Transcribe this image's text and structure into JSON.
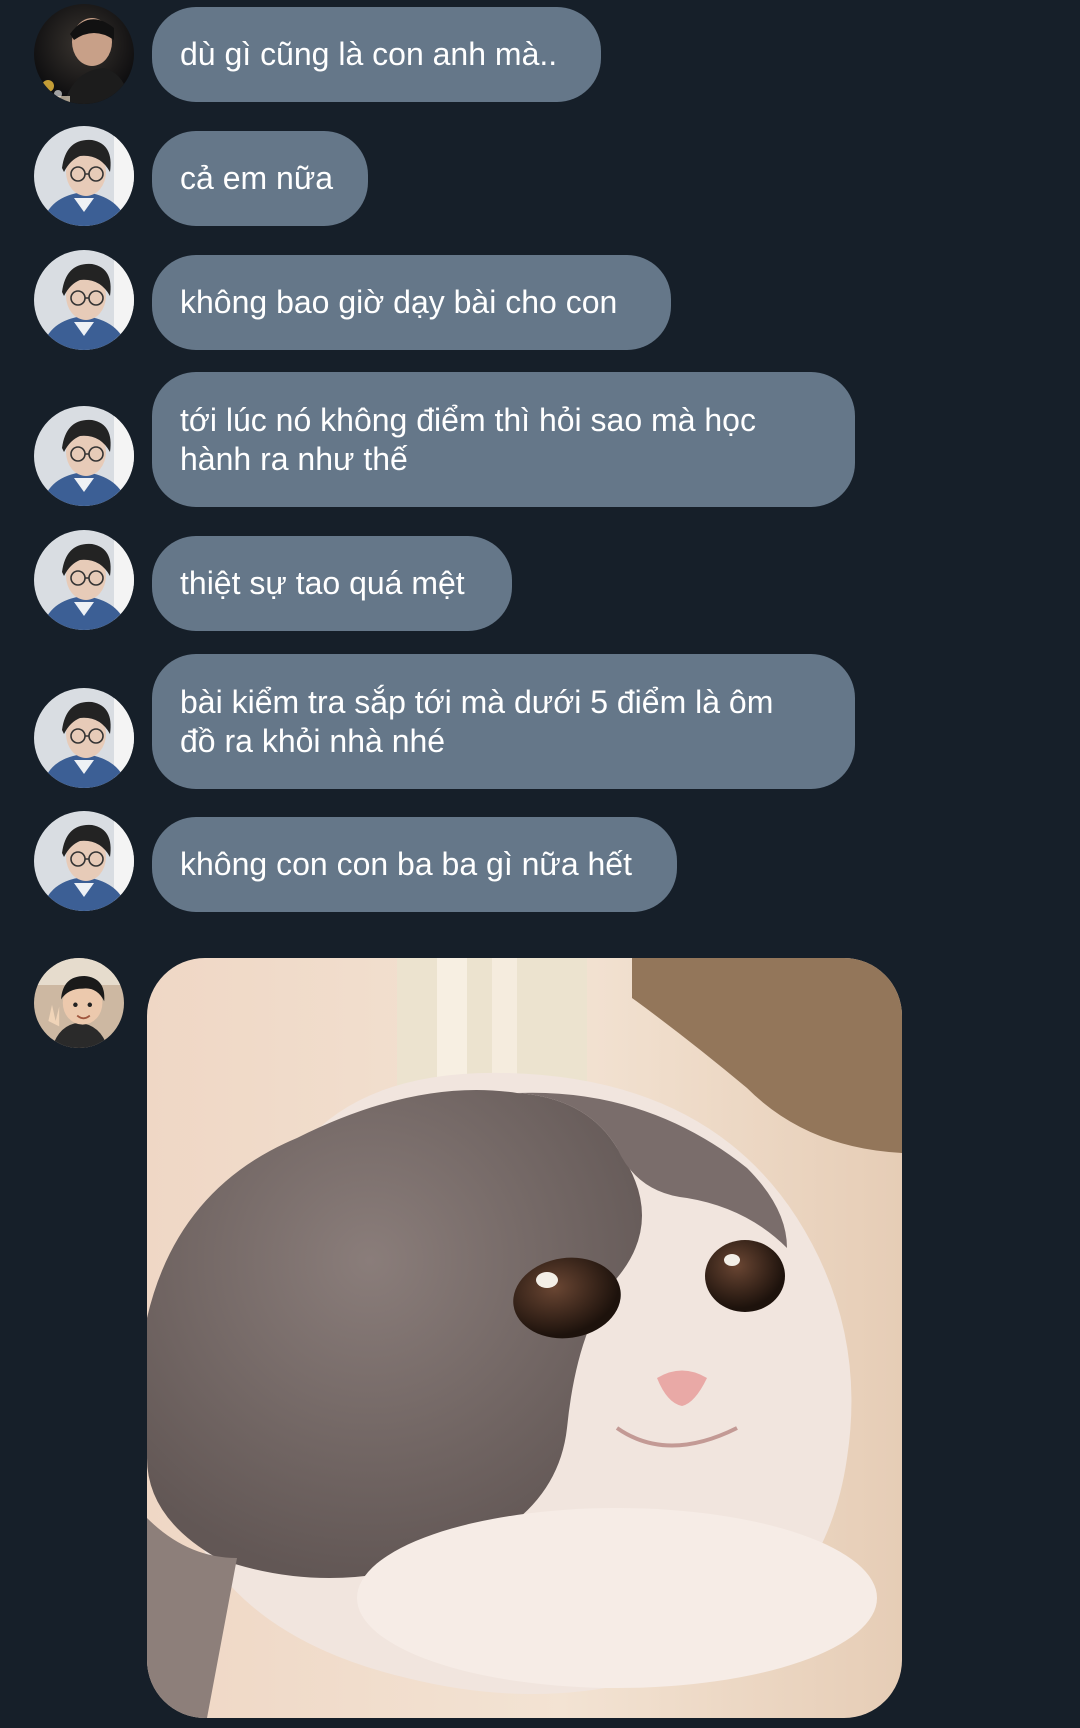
{
  "messages": [
    {
      "sender": "user-a",
      "text": "dù gì cũng là con anh mà.."
    },
    {
      "sender": "user-b",
      "text": "cả em nữa"
    },
    {
      "sender": "user-b",
      "text": "không bao giờ dạy bài cho con"
    },
    {
      "sender": "user-b",
      "text": "tới lúc nó không điểm thì hỏi sao mà học\nhành ra như thế"
    },
    {
      "sender": "user-b",
      "text": "thiệt sự tao quá mệt"
    },
    {
      "sender": "user-b",
      "text": "bài kiểm tra sắp tới mà dưới 5 điểm là ôm\nđồ ra khỏi nhà nhé"
    },
    {
      "sender": "user-b",
      "text": "không con con ba ba gì nữa hết"
    }
  ],
  "image_message": {
    "sender": "user-c",
    "content": "cat-photo"
  },
  "colors": {
    "background": "#161f29",
    "bubble": "#657789",
    "bubble_text": "#ffffff"
  }
}
